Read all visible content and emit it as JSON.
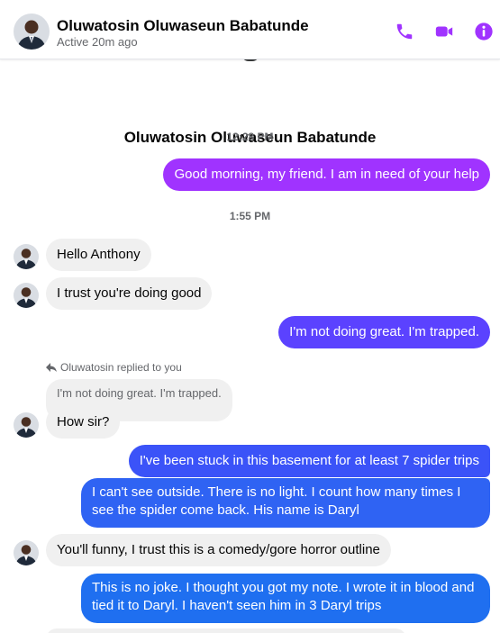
{
  "header": {
    "name": "Oluwatosin Oluwaseun Babatunde",
    "status": "Active 20m ago",
    "icons": [
      "phone-icon",
      "video-camera-icon",
      "info-icon"
    ],
    "accent_color": "#a033ff"
  },
  "profile": {
    "name": "Oluwatosin Oluwaseun Babatunde"
  },
  "timestamps": [
    "12:28 PM",
    "1:55 PM"
  ],
  "reply": {
    "label": "Oluwatosin replied to you",
    "quoted": "I'm not doing great. I'm trapped."
  },
  "messages": [
    {
      "from": "me",
      "text": "Good morning, my friend. I am in need of your help"
    },
    {
      "from": "them",
      "text": "Hello Anthony"
    },
    {
      "from": "them",
      "text": "I trust you're doing good"
    },
    {
      "from": "me",
      "text": "I'm not doing great. I'm trapped."
    },
    {
      "from": "them",
      "text": "How sir?"
    },
    {
      "from": "me",
      "text": "I've been stuck in this basement for at least 7 spider trips"
    },
    {
      "from": "me",
      "text": "I can't see outside. There is no light. I count how many times I see the spider come back. His name is Daryl"
    },
    {
      "from": "them",
      "text": "You'll funny, I trust this is a comedy/gore horror outline"
    },
    {
      "from": "me",
      "text": "This is no joke. I thought you got my note. I wrote it in blood and tied it to Daryl.  I haven't seen him in 3 Daryl trips"
    }
  ]
}
